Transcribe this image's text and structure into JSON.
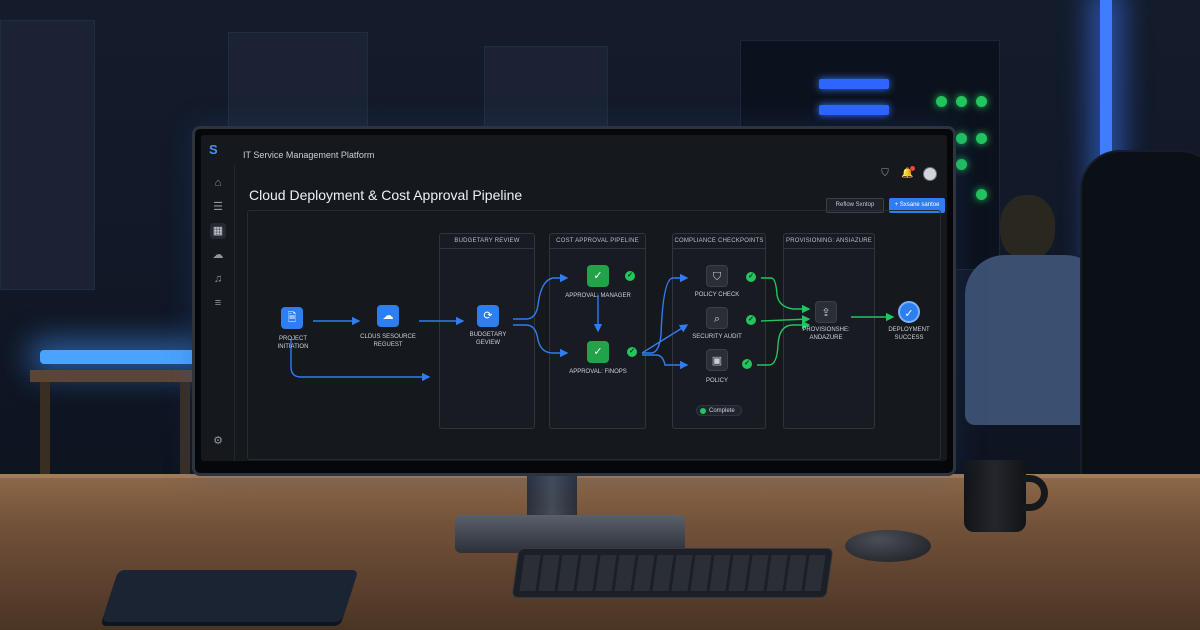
{
  "app": {
    "title": "IT Service Management Platform",
    "logo_icon": "brand-s-icon"
  },
  "header": {
    "page_title": "Cloud Deployment & Cost Approval Pipeline",
    "secondary_button": "Reflow Sxntop",
    "primary_button": "+ Sxsane santoe",
    "icons": [
      "shield-icon",
      "bell-icon",
      "avatar"
    ]
  },
  "sidebar": {
    "items": [
      {
        "icon": "home-icon"
      },
      {
        "icon": "list-icon"
      },
      {
        "icon": "grid-icon",
        "active": true
      },
      {
        "icon": "cloud-icon"
      },
      {
        "icon": "bell-icon"
      },
      {
        "icon": "settings-sliders-icon"
      },
      {
        "icon": "gear-icon"
      }
    ]
  },
  "pipeline": {
    "stages": {
      "budgetary": "BUDGETARY REVIEW",
      "cost": "COST APPROVAL PIPELINE",
      "compliance": "COMPLIANCE CHECKPOINTS",
      "provisioning": "PROVISIONING: ANSIAZURE"
    },
    "nodes": {
      "initiation": {
        "line1": "PROJECT",
        "line2": "INITIATION"
      },
      "request": {
        "line1": "CLDUS SESOURCE",
        "line2": "REGUEST"
      },
      "review": {
        "line1": "BUDGETARY",
        "line2": "GEVIEW"
      },
      "manager": {
        "label": "APPROVAL: MANAGER"
      },
      "finops": {
        "label": "APPROVAL: FINOPS"
      },
      "policy_check": {
        "label": "POLICY CHECK"
      },
      "security_audit": {
        "label": "SECURITY AUDIT"
      },
      "policy": {
        "label": "POLICY"
      },
      "provision": {
        "line1": "PROVISIONSHE:",
        "line2": "ANDAZURE"
      },
      "success": {
        "line1": "DEPLOYMENT",
        "line2": "SUCCESS"
      }
    },
    "complete_label": "Complete",
    "colors": {
      "accent": "#2f7df0",
      "success": "#22c55e"
    }
  }
}
